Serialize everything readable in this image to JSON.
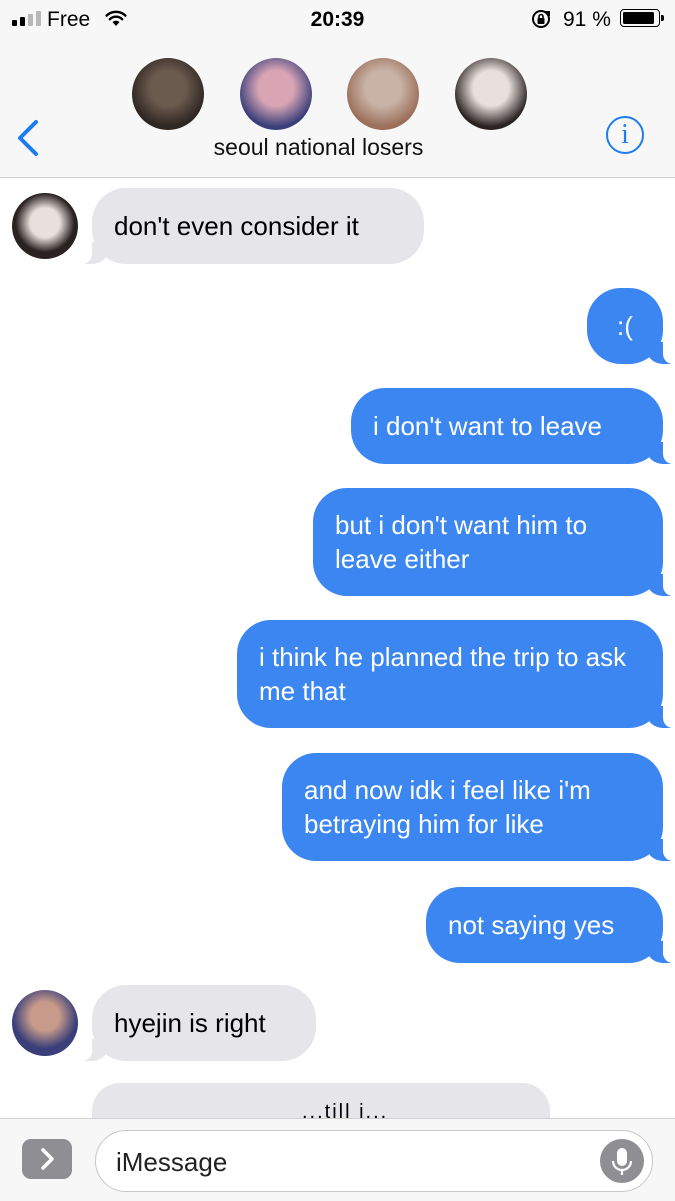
{
  "status_bar": {
    "carrier": "Free",
    "time": "20:39",
    "battery_percent": "91 %",
    "signal_bars": 2,
    "signal_total": 4
  },
  "header": {
    "group_name": "seoul national losers",
    "info_label": "i",
    "participants": [
      {
        "icon": "avatar-photo",
        "colors": [
          "#6b5a4e",
          "#2d2622"
        ]
      },
      {
        "icon": "avatar-photo",
        "colors": [
          "#d9a5b5",
          "#3a3f7a"
        ]
      },
      {
        "icon": "avatar-photo",
        "colors": [
          "#c9b3a6",
          "#9b6f5a"
        ]
      },
      {
        "icon": "avatar-photo",
        "colors": [
          "#e8e0dc",
          "#2a2221"
        ]
      }
    ]
  },
  "messages": [
    {
      "dir": "in",
      "text": "don't even consider it"
    },
    {
      "dir": "out",
      "text": ":("
    },
    {
      "dir": "out",
      "text": "i don't want to leave"
    },
    {
      "dir": "out",
      "text": "but i don't want him to leave either"
    },
    {
      "dir": "out",
      "text": "i think he planned the trip to ask me that"
    },
    {
      "dir": "out",
      "text": "and now idk i feel like i'm betraying him for like"
    },
    {
      "dir": "out",
      "text": "not saying yes"
    },
    {
      "dir": "in",
      "text": "hyejin is right"
    }
  ],
  "peek_text": "...till i...",
  "input": {
    "placeholder": "iMessage"
  },
  "colors": {
    "accent": "#1e7cf2",
    "outgoing_bubble": "#3b86f0",
    "incoming_bubble": "#e5e5ea"
  }
}
